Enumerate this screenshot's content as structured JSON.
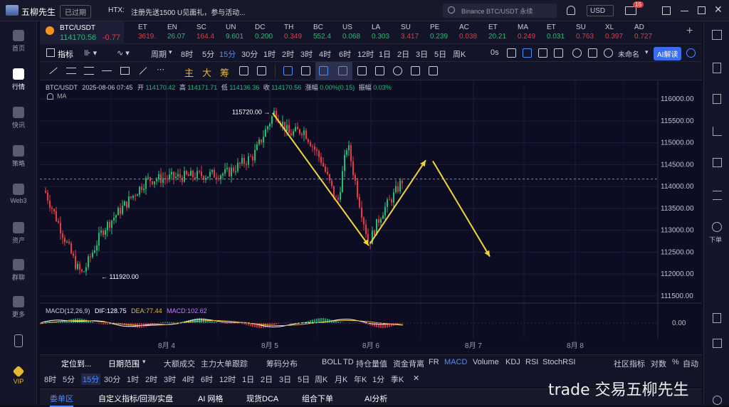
{
  "titlebar": {
    "app_name": "五柳先生",
    "status_badge": "已过期",
    "news_prefix": "HTX:",
    "news_text": "注册先送1500 U见面礼，参与活动...",
    "search_placeholder": "Binance BTC/USDT 永续",
    "currency": "USD",
    "notif_count": "16"
  },
  "leftnav": {
    "items": [
      "首页",
      "行情",
      "快讯",
      "策略",
      "Web3",
      "资产",
      "群聊",
      "更多",
      "",
      "VIP"
    ]
  },
  "rightnav": {
    "order_label": "下单"
  },
  "tickers": [
    {
      "name": "BTC/USDT",
      "price": "114170.56",
      "change": "-0.77"
    },
    {
      "name": "ET",
      "value": "3619.",
      "dir": "dn"
    },
    {
      "name": "EN",
      "value": "26.07",
      "dir": "up"
    },
    {
      "name": "SC",
      "value": "164.4",
      "dir": "dn"
    },
    {
      "name": "UN",
      "value": "9.601",
      "dir": "up"
    },
    {
      "name": "DC",
      "value": "0.200",
      "dir": "up"
    },
    {
      "name": "TH",
      "value": "0.349",
      "dir": "dn"
    },
    {
      "name": "BC",
      "value": "552.4",
      "dir": "up"
    },
    {
      "name": "US",
      "value": "0.068",
      "dir": "up"
    },
    {
      "name": "LA",
      "value": "0.303",
      "dir": "up"
    },
    {
      "name": "SU",
      "value": "3.417",
      "dir": "dn"
    },
    {
      "name": "PE",
      "value": "0.239",
      "dir": "up"
    },
    {
      "name": "AC",
      "value": "0.038",
      "dir": "dn"
    },
    {
      "name": "ET",
      "value": "20.21",
      "dir": "up"
    },
    {
      "name": "MA",
      "value": "0.249",
      "dir": "dn"
    },
    {
      "name": "ET",
      "value": "0.031",
      "dir": "up"
    },
    {
      "name": "SU",
      "value": "0.763",
      "dir": "dn"
    },
    {
      "name": "XL",
      "value": "0.397",
      "dir": "dn"
    },
    {
      "name": "AD",
      "value": "0.727",
      "dir": "dn"
    }
  ],
  "toolbar1": {
    "indicators": "指标",
    "period": "周期",
    "timeframes": [
      "8时",
      "5分",
      "15分",
      "30分",
      "1时",
      "2时",
      "3时",
      "4时",
      "6时",
      "12时",
      "1日",
      "2日",
      "3日",
      "5日",
      "周K"
    ],
    "selected_timeframe": "15分",
    "countdown": "0s",
    "unnamed": "未命名",
    "ai_button": "AI解读"
  },
  "toolbar2": {
    "tools": [
      "主",
      "大",
      "筹"
    ]
  },
  "chart_info": {
    "symbol": "BTC/USDT",
    "datetime": "2025-08-06 07:45",
    "open_label": "开",
    "open": "114170.42",
    "high_label": "高",
    "high": "114171.71",
    "low_label": "低",
    "low": "114136.36",
    "close_label": "收",
    "close": "114170.56",
    "chg_label": "涨幅",
    "chg": "0.00%(0.15)",
    "amp_label": "振幅",
    "amp": "0.03%",
    "ma": "MA"
  },
  "macd_info": {
    "label": "MACD(12,26,9)",
    "dif": "DIF:128.75",
    "dea": "DEA:77.44",
    "macd": "MACD:102.62",
    "zero": "0.00"
  },
  "chart_data": {
    "type": "candlestick",
    "symbol": "BTC/USDT",
    "interval": "15m",
    "y_ticks": [
      116000,
      115500,
      115000,
      114500,
      114000,
      113500,
      113000,
      112500,
      112000,
      111500
    ],
    "x_ticks": [
      "8月 4",
      "8月 5",
      "8月 6",
      "8月 7",
      "8月 8"
    ],
    "high_marker": "115720.00",
    "low_marker": "111920.00",
    "last_price": 114170.56,
    "key_points": [
      [
        "start",
        113900
      ],
      [
        "low",
        111920
      ],
      [
        "rise",
        114300
      ],
      [
        "high",
        115720
      ],
      [
        "low2",
        112700
      ],
      [
        "now",
        114170.56
      ]
    ],
    "projection": [
      "114600",
      "112400"
    ]
  },
  "indbar": {
    "position": "定位到...",
    "range": "日期范围",
    "items": [
      "大额成交",
      "主力大单跟踪",
      "筹码分布",
      "BOLL",
      "TD",
      "持仓量值",
      "资金背离",
      "FR",
      "MACD",
      "Volume",
      "KDJ",
      "RSI",
      "StochRSI"
    ],
    "selected": "MACD",
    "community": "社区指标",
    "log": "对数",
    "pct": "%",
    "auto": "自动"
  },
  "tfbar2": {
    "items": [
      "8时",
      "5分",
      "15分",
      "30分",
      "1时",
      "2时",
      "3时",
      "4时",
      "6时",
      "12时",
      "1日",
      "2日",
      "3日",
      "5日",
      "周K",
      "月K",
      "年K",
      "1分",
      "季K"
    ],
    "selected": "15分"
  },
  "bottombar": {
    "tabs": [
      "委单区",
      "自定义指标/回测/实盘",
      "AI 网格",
      "现货DCA",
      "组合下单",
      "AI分析"
    ]
  },
  "watermark": "trade 交易五柳先生"
}
